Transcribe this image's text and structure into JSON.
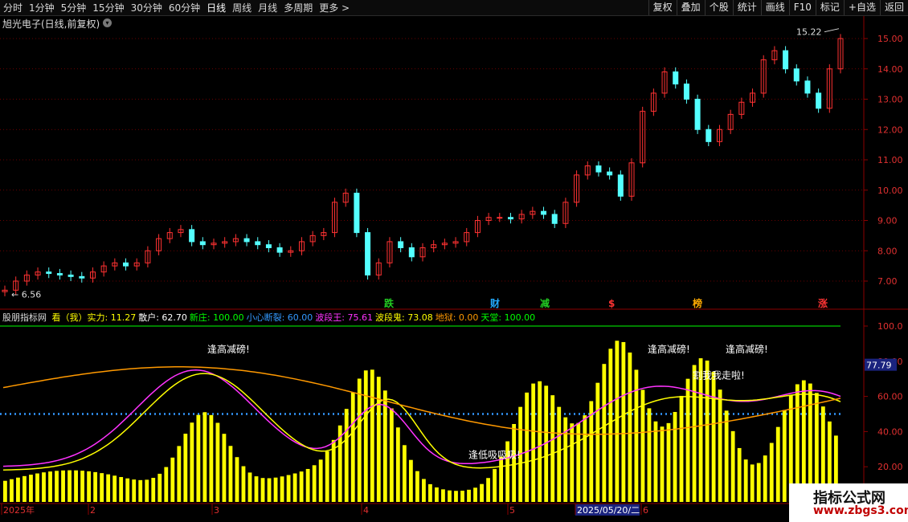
{
  "timeframes": [
    "分时",
    "1分钟",
    "5分钟",
    "15分钟",
    "30分钟",
    "60分钟",
    "日线",
    "周线",
    "月线",
    "多周期",
    "更多 >"
  ],
  "active_timeframe": "日线",
  "tools": [
    "复权",
    "叠加",
    "个股",
    "统计",
    "画线",
    "F10",
    "标记",
    "+自选",
    "返回"
  ],
  "stock_title": "旭光电子(日线,前复权)",
  "price_axis": {
    "ticks": [
      "15.00",
      "14.00",
      "13.00",
      "12.00",
      "11.00",
      "10.00",
      "9.00",
      "8.00",
      "7.00"
    ],
    "high_label": "15.22",
    "low_label": "6.56"
  },
  "markers": [
    {
      "text": "跌",
      "color": "#22cc22"
    },
    {
      "text": "财",
      "color": "#22aaff"
    },
    {
      "text": "减",
      "color": "#22cc22"
    },
    {
      "text": "$",
      "color": "#ff3333"
    },
    {
      "text": "榜",
      "color": "#ffaa00"
    },
    {
      "text": "涨",
      "color": "#ff3333"
    }
  ],
  "indicator": {
    "name": "股朋指标网",
    "items": [
      {
        "label": "看（我）实力: 11.27",
        "color": "#ffff00"
      },
      {
        "label": "散户: 62.70",
        "color": "#ffffff"
      },
      {
        "label": "新庄: 100.00",
        "color": "#00ff00"
      },
      {
        "label": "小心断裂: 60.00",
        "color": "#3399ff"
      },
      {
        "label": "波段王: 75.61",
        "color": "#ff33ff"
      },
      {
        "label": "波段鬼: 73.08",
        "color": "#ffff00"
      },
      {
        "label": "地狱: 0.00",
        "color": "#ff9900"
      },
      {
        "label": "天堂: 100.00",
        "color": "#00ff00"
      }
    ],
    "axis_ticks": [
      "100.0",
      "80.00",
      "60.00",
      "40.00",
      "20.00"
    ],
    "current_value": "77.79",
    "annotations": [
      "逢高减磅!",
      "逢高减磅!",
      "逢高减磅!",
      "逢低吸吸吸!",
      "割我我走啦!"
    ]
  },
  "date_axis": [
    "2025年",
    "2",
    "3",
    "4",
    "5",
    "2025/05/20/二",
    "6"
  ],
  "watermark": {
    "line1": "指标公式网",
    "line2": "www.zbgs3.com"
  },
  "colors": {
    "up": "#ff3232",
    "down": "#54ffff",
    "grid": "#8b0000",
    "bar": "#ffff00"
  },
  "price_series": [
    6.7,
    7.0,
    7.2,
    7.3,
    7.25,
    7.2,
    7.15,
    7.1,
    7.3,
    7.5,
    7.6,
    7.5,
    7.6,
    8.0,
    8.4,
    8.6,
    8.7,
    8.3,
    8.2,
    8.25,
    8.3,
    8.4,
    8.3,
    8.2,
    8.1,
    7.95,
    8.0,
    8.3,
    8.5,
    8.6,
    9.6,
    9.9,
    8.6,
    7.2,
    7.6,
    8.3,
    8.1,
    7.8,
    8.1,
    8.2,
    8.25,
    8.3,
    8.6,
    9.0,
    9.1,
    9.1,
    9.05,
    9.2,
    9.3,
    9.2,
    8.9,
    9.6,
    10.5,
    10.8,
    10.6,
    10.5,
    9.8,
    10.9,
    12.6,
    13.2,
    13.9,
    13.5,
    13.0,
    12.0,
    11.6,
    12.0,
    12.5,
    12.9,
    13.2,
    14.3,
    14.6,
    14.0,
    13.6,
    13.2,
    12.7,
    14.0,
    15.0
  ]
}
